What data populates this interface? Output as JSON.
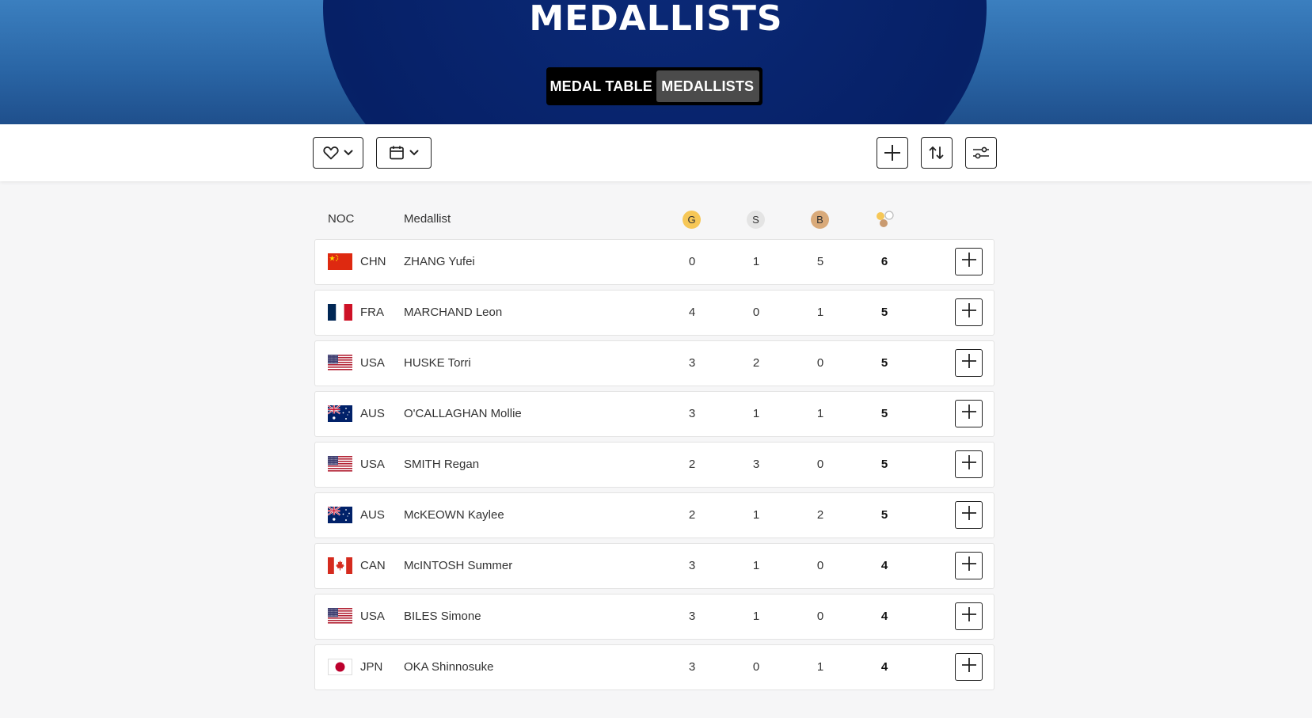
{
  "hero": {
    "title": "MEDALLISTS",
    "tabs": [
      {
        "label": "MEDAL TABLE",
        "active": false
      },
      {
        "label": "MEDALLISTS",
        "active": true
      }
    ]
  },
  "toolbar": {
    "left_buttons": [
      "heart-icon",
      "calendar-icon"
    ],
    "right_buttons": [
      "plus-icon",
      "sort-icon",
      "filter-sliders-icon"
    ]
  },
  "table": {
    "headers": {
      "noc": "NOC",
      "medallist": "Medallist",
      "gold": "G",
      "silver": "S",
      "bronze": "B",
      "total_icon": "total-medals-icon"
    },
    "medal_colors": {
      "gold": "#f6c757",
      "silver": "#e4e4e4",
      "bronze": "#d9aa7a"
    },
    "rows": [
      {
        "flag": "CHN",
        "noc": "CHN",
        "name": "ZHANG Yufei",
        "gold": "0",
        "silver": "1",
        "bronze": "5",
        "total": "6"
      },
      {
        "flag": "FRA",
        "noc": "FRA",
        "name": "MARCHAND Leon",
        "gold": "4",
        "silver": "0",
        "bronze": "1",
        "total": "5"
      },
      {
        "flag": "USA",
        "noc": "USA",
        "name": "HUSKE Torri",
        "gold": "3",
        "silver": "2",
        "bronze": "0",
        "total": "5"
      },
      {
        "flag": "AUS",
        "noc": "AUS",
        "name": "O'CALLAGHAN Mollie",
        "gold": "3",
        "silver": "1",
        "bronze": "1",
        "total": "5"
      },
      {
        "flag": "USA",
        "noc": "USA",
        "name": "SMITH Regan",
        "gold": "2",
        "silver": "3",
        "bronze": "0",
        "total": "5"
      },
      {
        "flag": "AUS",
        "noc": "AUS",
        "name": "McKEOWN Kaylee",
        "gold": "2",
        "silver": "1",
        "bronze": "2",
        "total": "5"
      },
      {
        "flag": "CAN",
        "noc": "CAN",
        "name": "McINTOSH Summer",
        "gold": "3",
        "silver": "1",
        "bronze": "0",
        "total": "4"
      },
      {
        "flag": "USA",
        "noc": "USA",
        "name": "BILES Simone",
        "gold": "3",
        "silver": "1",
        "bronze": "0",
        "total": "4"
      },
      {
        "flag": "JPN",
        "noc": "JPN",
        "name": "OKA Shinnosuke",
        "gold": "3",
        "silver": "0",
        "bronze": "1",
        "total": "4"
      }
    ]
  }
}
